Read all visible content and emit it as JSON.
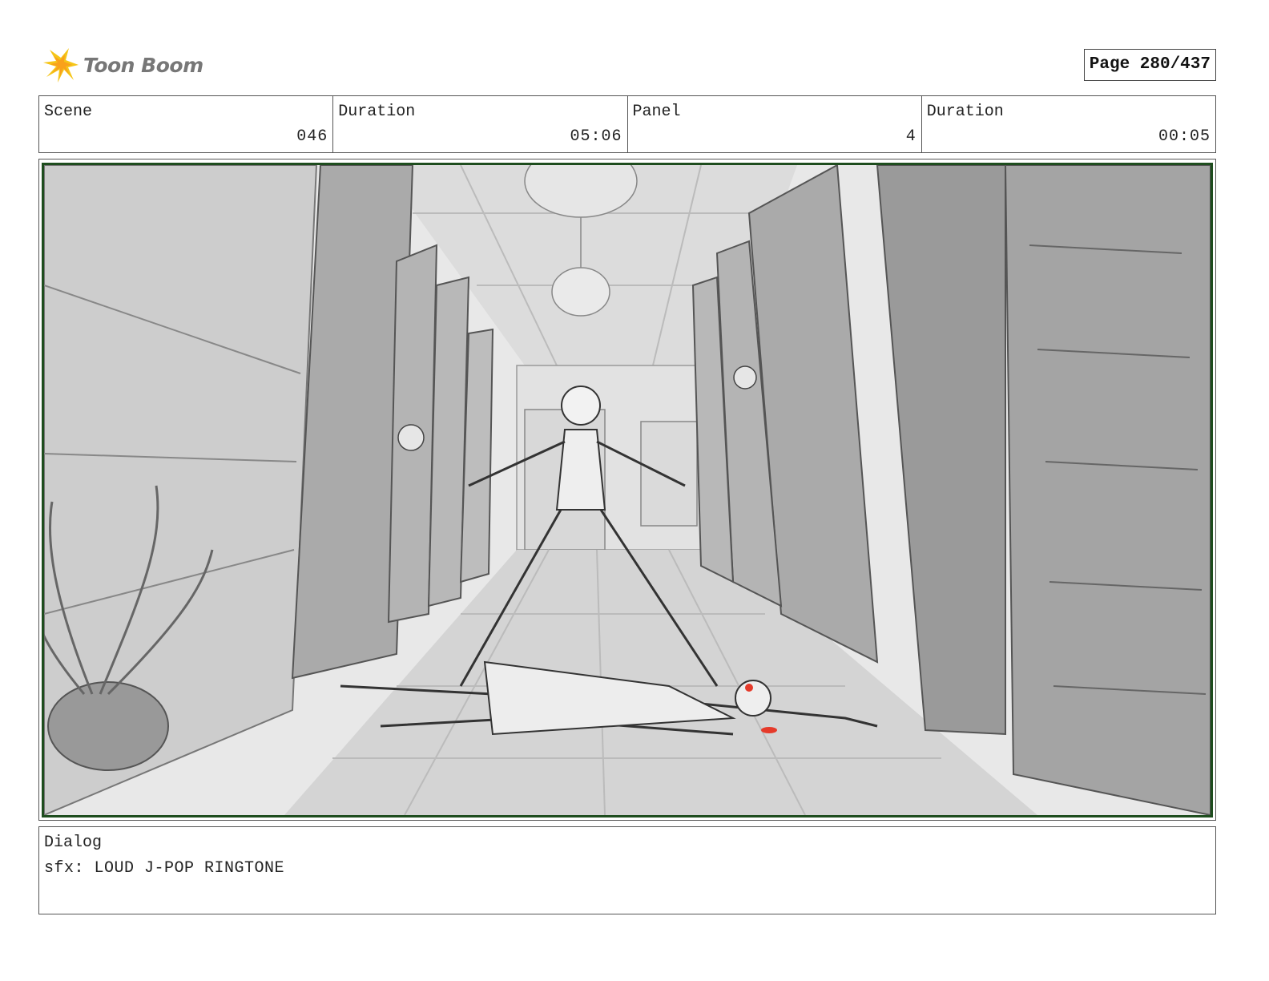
{
  "header": {
    "brand": "Toon Boom",
    "page_label": "Page 280/437"
  },
  "info": {
    "scene_label": "Scene",
    "scene_value": "046",
    "duration_label": "Duration",
    "duration_value": "05:06",
    "panel_label": "Panel",
    "panel_value": "4",
    "panel_duration_label": "Duration",
    "panel_duration_value": "00:05"
  },
  "panel_image": {
    "icon": "storyboard-sketch",
    "accent_color": "#e53a2a",
    "frame_color": "#1e4d1e"
  },
  "dialog": {
    "label": "Dialog",
    "text": "sfx: LOUD J-POP RINGTONE"
  },
  "colors": {
    "logo_yellow": "#f5c518",
    "logo_text": "#777777"
  }
}
